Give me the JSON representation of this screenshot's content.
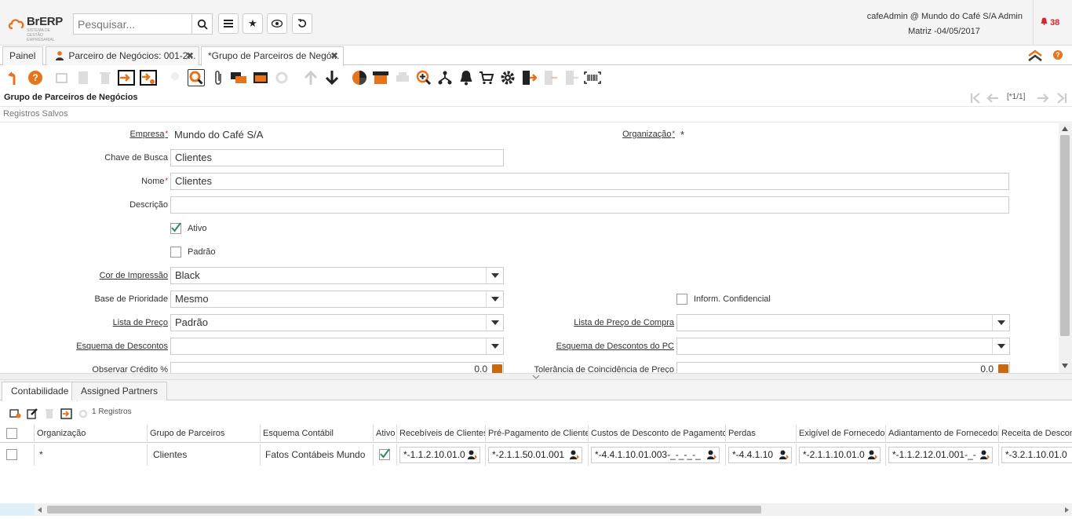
{
  "header": {
    "logo_text": "BrERP",
    "logo_sub": "SISTEMA DE GESTÃO EMPRESARIAL",
    "search_placeholder": "Pesquisar...",
    "user_line1": "cafeAdmin @ Mundo do Café S/A Admin",
    "user_line2": "Matriz -04/05/2017",
    "notifications": "38"
  },
  "tabs": [
    {
      "label": "Painel"
    },
    {
      "label": "Parceiro de Negócios: 001-2..."
    },
    {
      "label": "*Grupo de Parceiros de Negó..."
    }
  ],
  "window": {
    "title": "Grupo de Parceiros de Negócios",
    "record_nav": "[*1/1]",
    "saved_records": "Registros Salvos"
  },
  "form": {
    "empresa_label": "Empresa",
    "empresa_value": "Mundo do Café S/A",
    "organizacao_label": "Organização",
    "organizacao_value": "*",
    "chave_label": "Chave de Busca",
    "chave_value": "Clientes",
    "nome_label": "Nome",
    "nome_value": "Clientes",
    "descricao_label": "Descrição",
    "descricao_value": "",
    "ativo_label": "Ativo",
    "padrao_label": "Padrão",
    "cor_label": "Cor de Impressão",
    "cor_value": "Black",
    "base_label": "Base de Prioridade",
    "base_value": "Mesmo",
    "confidencial_label": "Inform. Confidencial",
    "lista_label": "Lista de Preço",
    "lista_value": "Padrão",
    "lista_compra_label": "Lista de Preço de Compra",
    "lista_compra_value": "",
    "esquema_label": "Esquema de Descontos",
    "esquema_value": "",
    "esquema_pc_label": "Esquema de Descontos do PC",
    "esquema_pc_value": "",
    "credito_label": "Observar Crédito %",
    "credito_value": "0.0",
    "tolerancia_label": "Tolerância de Coincidência de Preço",
    "tolerancia_value": "0.0"
  },
  "detail": {
    "tabs": [
      {
        "label": "Contabilidade"
      },
      {
        "label": "Assigned Partners"
      }
    ],
    "count": "1 Registros",
    "columns": [
      "Organização",
      "Grupo de Parceiros",
      "Esquema Contábil",
      "Ativo",
      "Recebíveis de Clientes",
      "Pré-Pagamento de Cliente",
      "Custos de Desconto de Pagamento",
      "Perdas",
      "Exigível de Fornecedor",
      "Adiantamento de Fornecedor",
      "Receita de Descon"
    ],
    "row": {
      "organizacao": "*",
      "grupo": "Clientes",
      "esquema": "Fatos Contábeis Mundo",
      "recebiveis": "*-1.1.2.10.01.0",
      "pre_pagamento": "*-2.1.1.50.01.001",
      "custos_desconto": "*-4.4.1.10.01.003-_-_-_-_",
      "perdas": "*-4.4.1.10",
      "exigivel": "*-2.1.1.10.01.0",
      "adiantamento": "*-1.1.2.12.01.001-_-",
      "receita": "*-3.2.1.10.01.0"
    }
  }
}
